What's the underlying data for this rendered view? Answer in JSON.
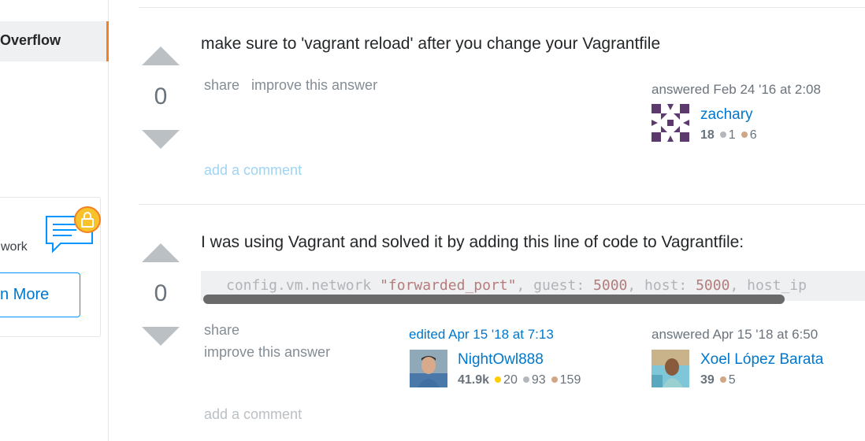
{
  "sidebar": {
    "active_item": "Overflow",
    "promo": {
      "text": "work",
      "button_label": "n More"
    }
  },
  "answers": [
    {
      "votes": "0",
      "body": "make sure to 'vagrant reload' after you change your Vagrantfile",
      "menu": {
        "share": "share",
        "improve": "improve this answer"
      },
      "answered": {
        "action": "answered Feb 24 '16 at 2:08",
        "user": "zachary",
        "reputation": "18",
        "silver": "1",
        "bronze": "6"
      },
      "add_comment": "add a comment"
    },
    {
      "votes": "0",
      "body": "I was using Vagrant and solved it by adding this line of code to Vagrantfile:",
      "code": {
        "prefix": "config.vm.network ",
        "str": "\"forwarded_port\"",
        "mid1": ", guest: ",
        "num1": "5000",
        "mid2": ", host: ",
        "num2": "5000",
        "tail": ", host_ip"
      },
      "menu": {
        "share": "share",
        "improve": "improve this answer"
      },
      "edited": {
        "action": "edited Apr 15 '18 at 7:13",
        "user": "NightOwl888",
        "reputation": "41.9k",
        "gold": "20",
        "silver": "93",
        "bronze": "159"
      },
      "answered": {
        "action": "answered Apr 15 '18 at 6:50",
        "user": "Xoel López Barata",
        "reputation": "39",
        "bronze": "5"
      },
      "add_comment": "add a comment"
    }
  ],
  "colors": {
    "accent_orange": "#f48024",
    "link_blue": "#0077cc",
    "comment_link": "#9fd4f2",
    "muted_comment": "#bbc0c4",
    "gold_badge": "#ffcc01",
    "silver_badge": "#b4b8bc",
    "bronze_badge": "#d1a684"
  }
}
